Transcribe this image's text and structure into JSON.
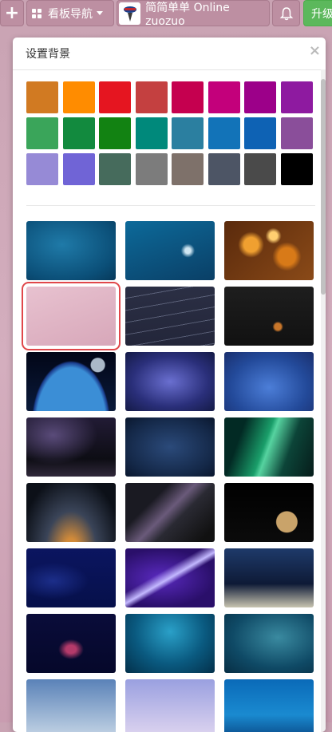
{
  "toolbar": {
    "add_icon": "plus-icon",
    "kanban_label": "看板导航",
    "board_label": "简简单单 Online zuozuo",
    "bell_icon": "bell-icon",
    "upgrade_label": "升级"
  },
  "modal": {
    "title": "设置背景",
    "close_label": "×"
  },
  "swatch_colors": [
    "#d17a22",
    "#ff8c00",
    "#e51520",
    "#c44040",
    "#c5004f",
    "#c3007b",
    "#9c0089",
    "#8e1aa0",
    "#3aa55a",
    "#128a3e",
    "#128212",
    "#00897b",
    "#2b7fa0",
    "#1273b8",
    "#0e62b4",
    "#8a4e9a",
    "#968ad6",
    "#7064d6",
    "#466b5c",
    "#7c7c7c",
    "#7e716a",
    "#4d5565",
    "#4a4a4a",
    "#000000"
  ],
  "backgrounds": [
    {
      "name": "blue-texture",
      "selected": false
    },
    {
      "name": "blue-ice",
      "selected": false
    },
    {
      "name": "bokeh-lights",
      "selected": false
    },
    {
      "name": "pink-book",
      "selected": true
    },
    {
      "name": "dark-waves",
      "selected": false
    },
    {
      "name": "dark-bird",
      "selected": false
    },
    {
      "name": "earth-horizon",
      "selected": false
    },
    {
      "name": "storm-clouds",
      "selected": false
    },
    {
      "name": "blue-clouds",
      "selected": false
    },
    {
      "name": "milky-way-lake",
      "selected": false
    },
    {
      "name": "starry-sky",
      "selected": false
    },
    {
      "name": "aurora",
      "selected": false
    },
    {
      "name": "night-horizon",
      "selected": false
    },
    {
      "name": "galaxy-road",
      "selected": false
    },
    {
      "name": "moon",
      "selected": false
    },
    {
      "name": "world-map",
      "selected": false
    },
    {
      "name": "purple-beam",
      "selected": false
    },
    {
      "name": "night-grass",
      "selected": false
    },
    {
      "name": "christmas-tree",
      "selected": false
    },
    {
      "name": "underwater-shark",
      "selected": false
    },
    {
      "name": "ocean-sharks",
      "selected": false
    },
    {
      "name": "pale-sky",
      "selected": false
    },
    {
      "name": "lavender-sky",
      "selected": false
    },
    {
      "name": "blue-ocean",
      "selected": false
    }
  ]
}
